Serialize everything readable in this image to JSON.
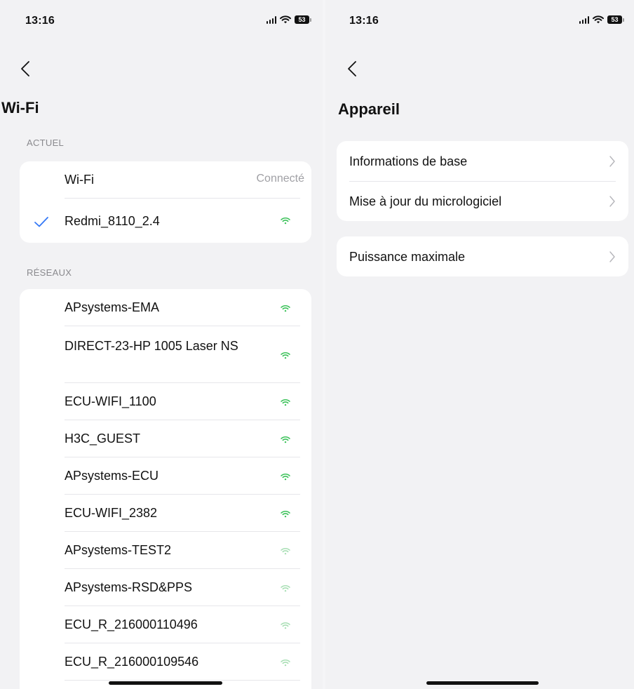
{
  "left": {
    "status": {
      "time": "13:16",
      "battery": "53"
    },
    "title": "Wi-Fi",
    "current_header": "ACTUEL",
    "current": {
      "wifi_label": "Wi-Fi",
      "wifi_status": "Connecté",
      "connected_network": "Redmi_8110_2.4"
    },
    "networks_header": "RÉSEAUX",
    "networks": [
      {
        "name": "APsystems-EMA",
        "signal": "strong"
      },
      {
        "name": "DIRECT-23-HP 1005 Laser NS",
        "signal": "strong"
      },
      {
        "name": "ECU-WIFI_1100",
        "signal": "strong"
      },
      {
        "name": "H3C_GUEST",
        "signal": "strong"
      },
      {
        "name": "APsystems-ECU",
        "signal": "strong"
      },
      {
        "name": "ECU-WIFI_2382",
        "signal": "strong"
      },
      {
        "name": "APsystems-TEST2",
        "signal": "weak"
      },
      {
        "name": "APsystems-RSD&PPS",
        "signal": "weak"
      },
      {
        "name": "ECU_R_216000110496",
        "signal": "weak"
      },
      {
        "name": "ECU_R_216000109546",
        "signal": "weak"
      }
    ]
  },
  "right": {
    "status": {
      "time": "13:16",
      "battery": "53"
    },
    "title": "Appareil",
    "group1": [
      "Informations de base",
      "Mise à jour du micrologiciel"
    ],
    "group2": [
      "Puissance maximale"
    ]
  },
  "colors": {
    "accent": "#3478f6",
    "wifi_strong": "#3cc25a",
    "wifi_weak": "#a9dfb5",
    "chevron": "#b5b5ba",
    "background": "#f2f2f4"
  },
  "icons": [
    "back-chevron-icon",
    "wifi-icon",
    "checkmark-icon",
    "chevron-right-icon",
    "cellular-signal-icon",
    "battery-icon"
  ]
}
